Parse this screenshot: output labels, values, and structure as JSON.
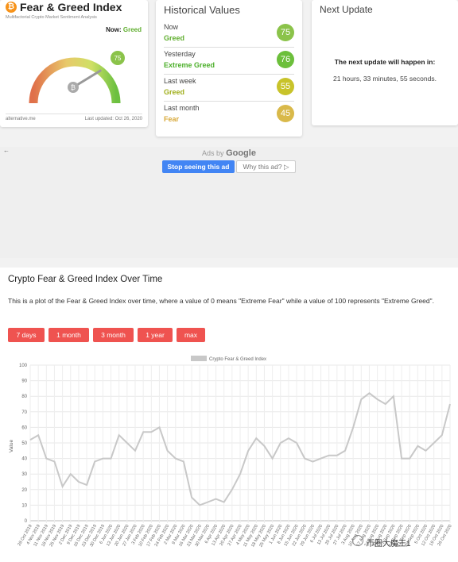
{
  "fear_greed_card": {
    "logo_letter": "₿",
    "title": "Fear & Greed Index",
    "subtitle": "Multifactorial Crypto Market Sentiment Analysis",
    "now_label": "Now:",
    "now_value": "Greed",
    "gauge_value": "75",
    "gauge_value_numeric": 75,
    "source": "alternative.me",
    "last_updated": "Last updated: Oct 26, 2020"
  },
  "historical": {
    "title": "Historical Values",
    "rows": [
      {
        "label": "Now",
        "classification": "Greed",
        "value": "75",
        "color": "#8bc34a",
        "text_color": "#5fae2e"
      },
      {
        "label": "Yesterday",
        "classification": "Extreme Greed",
        "value": "76",
        "color": "#6cbf3b",
        "text_color": "#4caf2a"
      },
      {
        "label": "Last week",
        "classification": "Greed",
        "value": "55",
        "color": "#c8c32a",
        "text_color": "#9fae1a"
      },
      {
        "label": "Last month",
        "classification": "Fear",
        "value": "45",
        "color": "#d9b94a",
        "text_color": "#d8a93a"
      }
    ]
  },
  "next_update": {
    "title": "Next Update",
    "message": "The next update will happen in:",
    "countdown": "21 hours, 33 minutes, 55 seconds."
  },
  "ad": {
    "back_arrow": "←",
    "ads_by": "Ads by",
    "brand": "Google",
    "stop_label": "Stop seeing this ad",
    "why_label": "Why this ad? ▷"
  },
  "main": {
    "title": "Crypto Fear & Greed Index Over Time",
    "description": "This is a plot of the Fear & Greed Index over time, where a value of 0 means \"Extreme Fear\" while a value of 100 represents \"Extreme Greed\".",
    "buttons": [
      "7 days",
      "1 month",
      "3 month",
      "1 year",
      "max"
    ]
  },
  "watermark": "币圈大魔王1",
  "colors": {
    "accent": "#ef5350",
    "series": "#c8c8c8",
    "google_blue": "#4285f4"
  },
  "chart_data": {
    "type": "line",
    "legend": "Crypto Fear & Greed Index",
    "ylabel": "Value",
    "ylim": [
      0,
      100
    ],
    "yticks": [
      0,
      10,
      20,
      30,
      40,
      50,
      60,
      70,
      80,
      90,
      100
    ],
    "x_tick_labels": [
      "28 Oct 2019",
      "4 Nov 2019",
      "11 Nov 2019",
      "18 Nov 2019",
      "25 Nov 2019",
      "2 Dec 2019",
      "9 Dec 2019",
      "16 Dec 2019",
      "23 Dec 2019",
      "30 Dec 2019",
      "6 Jan 2020",
      "13 Jan 2020",
      "20 Jan 2020",
      "27 Jan 2020",
      "3 Feb 2020",
      "10 Feb 2020",
      "17 Feb 2020",
      "24 Feb 2020",
      "2 Mar 2020",
      "9 Mar 2020",
      "16 Mar 2020",
      "23 Mar 2020",
      "30 Mar 2020",
      "6 Apr 2020",
      "13 Apr 2020",
      "20 Apr 2020",
      "27 Apr 2020",
      "4 May 2020",
      "11 May 2020",
      "18 May 2020",
      "25 May 2020",
      "1 Jun 2020",
      "8 Jun 2020",
      "15 Jun 2020",
      "22 Jun 2020",
      "29 Jun 2020",
      "6 Jul 2020",
      "13 Jul 2020",
      "20 Jul 2020",
      "27 Jul 2020",
      "3 Aug 2020",
      "10 Aug 2020",
      "17 Aug 2020",
      "24 Aug 2020",
      "31 Aug 2020",
      "7 Sep 2020",
      "14 Sep 2020",
      "21 Sep 2020",
      "28 Sep 2020",
      "5 Oct 2020",
      "12 Oct 2020",
      "19 Oct 2020",
      "26 Oct 2020"
    ],
    "weekly_values": [
      52,
      55,
      40,
      38,
      22,
      30,
      25,
      23,
      38,
      40,
      40,
      55,
      50,
      45,
      57,
      57,
      60,
      45,
      40,
      38,
      15,
      10,
      12,
      14,
      12,
      20,
      30,
      45,
      53,
      48,
      40,
      50,
      53,
      50,
      40,
      38,
      40,
      42,
      42,
      45,
      60,
      78,
      82,
      78,
      75,
      80,
      40,
      40,
      48,
      45,
      50,
      55,
      75
    ]
  }
}
